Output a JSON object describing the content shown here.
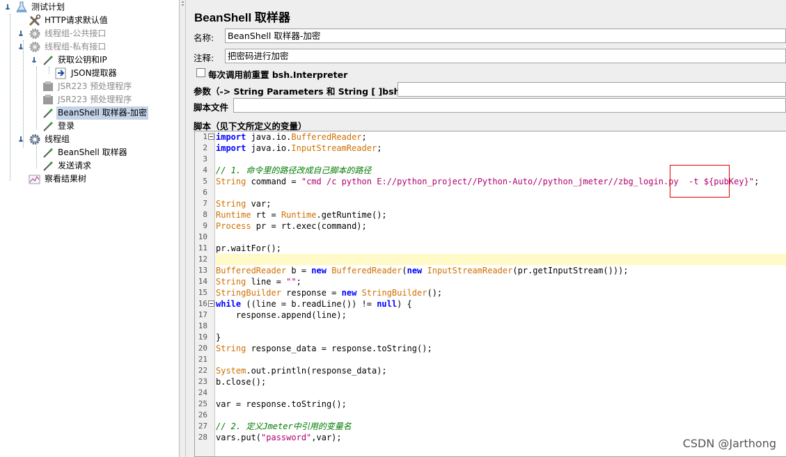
{
  "tree": {
    "items": [
      {
        "label": "测试计划",
        "icon": "test-plan-icon"
      },
      {
        "label": "HTTP请求默认值",
        "icon": "config-tools-icon"
      },
      {
        "label": "线程组-公共接口",
        "icon": "gear-icon"
      },
      {
        "label": "线程组-私有接口",
        "icon": "gear-icon"
      },
      {
        "label": "获取公钥和IP",
        "icon": "pipette-icon"
      },
      {
        "label": "JSON提取器",
        "icon": "extractor-arrow-icon"
      },
      {
        "label": "JSR223 预处理程序",
        "icon": "preprocessor-icon"
      },
      {
        "label": "JSR223 预处理程序",
        "icon": "preprocessor-icon"
      },
      {
        "label": "BeanShell 取样器-加密",
        "icon": "pipette-icon"
      },
      {
        "label": "登录",
        "icon": "pipette-icon"
      },
      {
        "label": "线程组",
        "icon": "gear-icon"
      },
      {
        "label": "BeanShell 取样器",
        "icon": "pipette-icon"
      },
      {
        "label": "发送请求",
        "icon": "pipette-icon"
      },
      {
        "label": "察看结果树",
        "icon": "chart-icon"
      }
    ]
  },
  "panel": {
    "title": "BeanShell 取样器",
    "name_label": "名称:",
    "name_value": "BeanShell 取样器-加密",
    "comment_label": "注释:",
    "comment_value": "把密码进行加密",
    "reset_label": "每次调用前重置 bsh.Interpreter",
    "params_label": "参数（-> String Parameters 和 String [ ]bsh.args）",
    "params_value": "",
    "script_file_label": "脚本文件",
    "script_file_value": "",
    "script_label": "脚本（见下文所定义的变量）"
  },
  "editor": {
    "line_numbers": [
      "1",
      "2",
      "3",
      "4",
      "5",
      "6",
      "7",
      "8",
      "9",
      "10",
      "11",
      "12",
      "13",
      "14",
      "15",
      "16",
      "17",
      "18",
      "19",
      "20",
      "21",
      "22",
      "23",
      "24",
      "25",
      "26",
      "27",
      "28"
    ],
    "highlight_line": "12",
    "lines": [
      [
        [
          "kw",
          "import"
        ],
        [
          "pl",
          " java.io."
        ],
        [
          "ty",
          "BufferedReader"
        ],
        [
          "pl",
          ";"
        ]
      ],
      [
        [
          "kw",
          "import"
        ],
        [
          "pl",
          " java.io."
        ],
        [
          "ty",
          "InputStreamReader"
        ],
        [
          "pl",
          ";"
        ]
      ],
      [],
      [
        [
          "cm",
          "// 1. 命令里的路径改成自己脚本的路径"
        ]
      ],
      [
        [
          "ty",
          "String"
        ],
        [
          "pl",
          " command = "
        ],
        [
          "st",
          "\"cmd /c python E://python_project//Python-Auto//python_jmeter//zbg_login.py  -t ${pubKey}\""
        ],
        [
          "pl",
          ";"
        ]
      ],
      [],
      [
        [
          "ty",
          "String"
        ],
        [
          "pl",
          " var;"
        ]
      ],
      [
        [
          "ty",
          "Runtime"
        ],
        [
          "pl",
          " rt = "
        ],
        [
          "ty",
          "Runtime"
        ],
        [
          "pl",
          ".getRuntime();"
        ]
      ],
      [
        [
          "ty",
          "Process"
        ],
        [
          "pl",
          " pr = rt.exec(command);"
        ]
      ],
      [],
      [
        [
          "pl",
          "pr.waitFor();"
        ]
      ],
      [],
      [
        [
          "ty",
          "BufferedReader"
        ],
        [
          "pl",
          " b = "
        ],
        [
          "kw",
          "new"
        ],
        [
          "pl",
          " "
        ],
        [
          "ty",
          "BufferedReader"
        ],
        [
          "pl",
          "("
        ],
        [
          "kw",
          "new"
        ],
        [
          "pl",
          " "
        ],
        [
          "ty",
          "InputStreamReader"
        ],
        [
          "pl",
          "(pr.getInputStream()));"
        ]
      ],
      [
        [
          "ty",
          "String"
        ],
        [
          "pl",
          " line = "
        ],
        [
          "st",
          "\"\""
        ],
        [
          "pl",
          ";"
        ]
      ],
      [
        [
          "ty",
          "StringBuilder"
        ],
        [
          "pl",
          " response = "
        ],
        [
          "kw",
          "new"
        ],
        [
          "pl",
          " "
        ],
        [
          "ty",
          "StringBuilder"
        ],
        [
          "pl",
          "();"
        ]
      ],
      [
        [
          "kw",
          "while"
        ],
        [
          "pl",
          " ((line = b.readLine()) != "
        ],
        [
          "kw",
          "null"
        ],
        [
          "pl",
          ") {"
        ]
      ],
      [
        [
          "pl",
          "    response.append(line);"
        ]
      ],
      [],
      [
        [
          "pl",
          "}"
        ]
      ],
      [
        [
          "ty",
          "String"
        ],
        [
          "pl",
          " response_data = response.toString();"
        ]
      ],
      [],
      [
        [
          "ty",
          "System"
        ],
        [
          "pl",
          ".out.println(response_data);"
        ]
      ],
      [
        [
          "pl",
          "b.close();"
        ]
      ],
      [],
      [
        [
          "pl",
          "var = response.toString();"
        ]
      ],
      [],
      [
        [
          "cm",
          "// 2. 定义Jmeter中引用的变量名"
        ]
      ],
      [
        [
          "pl",
          "vars.put("
        ],
        [
          "st",
          "\"password\""
        ],
        [
          "pl",
          ",var);"
        ]
      ]
    ]
  },
  "watermark": "CSDN @Jarthong"
}
